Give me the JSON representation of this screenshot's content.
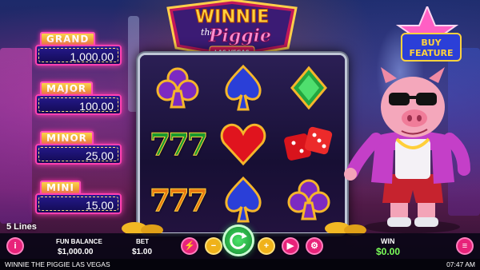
{
  "game": {
    "logo_line1": "WINNIE",
    "logo_line2": "the",
    "logo_line3": "Piggie",
    "logo_sub": "LAS VEGAS"
  },
  "jackpots": [
    {
      "label": "GRAND",
      "amount": "1,000.00"
    },
    {
      "label": "MAJOR",
      "amount": "100.00"
    },
    {
      "label": "MINOR",
      "amount": "25.00"
    },
    {
      "label": "MINI",
      "amount": "15.00"
    }
  ],
  "buy_feature": {
    "line1": "BUY",
    "line2": "FEATURE"
  },
  "reels": [
    [
      "club",
      "spade",
      "diamond"
    ],
    [
      "seven",
      "heart",
      "dice"
    ],
    [
      "seven",
      "spade",
      "club"
    ]
  ],
  "lines_label": "5 Lines",
  "balance": {
    "label": "FUN BALANCE",
    "value": "$1,000.00"
  },
  "bet": {
    "label": "BET",
    "value": "$1.00"
  },
  "win": {
    "label": "WIN",
    "value": "$0.00"
  },
  "status_bar": {
    "title": "WINNIE THE PIGGIE LAS VEGAS",
    "time": "07:47 AM"
  },
  "icons": {
    "info": "info-icon",
    "voltage": "turbo-icon",
    "minus": "minus-icon",
    "spin": "spin-icon",
    "plus": "plus-icon",
    "autoplay": "autoplay-icon",
    "settings": "settings-icon",
    "menu": "menu-icon"
  },
  "colors": {
    "accent": "#e8237a",
    "win": "#7cff5a",
    "spin": "#1fa83a"
  }
}
